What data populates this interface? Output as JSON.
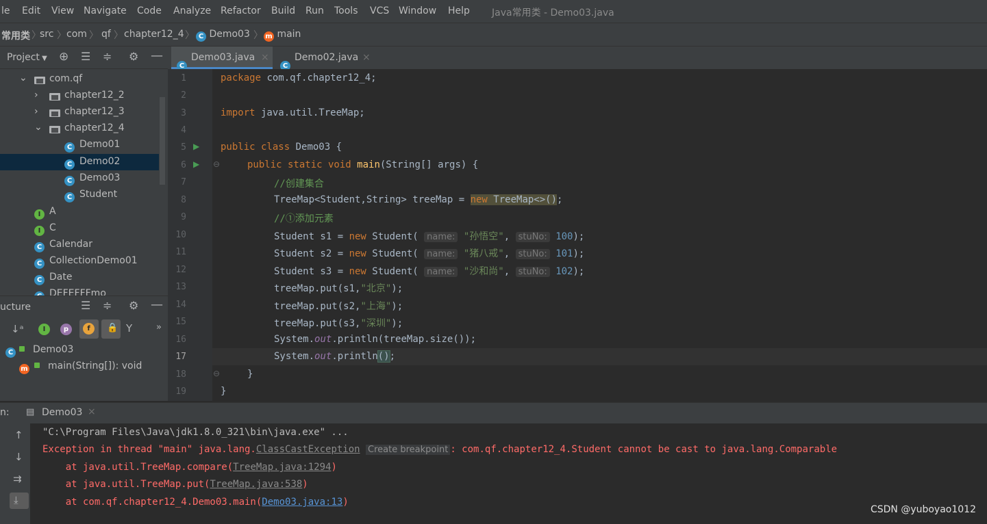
{
  "menu": {
    "items": [
      "le",
      "Edit",
      "View",
      "Navigate",
      "Code",
      "Analyze",
      "Refactor",
      "Build",
      "Run",
      "Tools",
      "VCS",
      "Window",
      "Help"
    ],
    "window_title": "Java常用类 - Demo03.java"
  },
  "breadcrumb": {
    "items": [
      "常用类",
      "src",
      "com",
      "qf",
      "chapter12_4",
      "Demo03",
      "main"
    ]
  },
  "project_panel": {
    "header": "Project",
    "tree": [
      {
        "label": "com.qf",
        "kind": "folder",
        "expanded": true
      },
      {
        "label": "chapter12_2",
        "kind": "folder",
        "expanded": false
      },
      {
        "label": "chapter12_3",
        "kind": "folder",
        "expanded": false
      },
      {
        "label": "chapter12_4",
        "kind": "folder",
        "expanded": true
      },
      {
        "label": "Demo01",
        "kind": "class"
      },
      {
        "label": "Demo02",
        "kind": "class",
        "selected": true
      },
      {
        "label": "Demo03",
        "kind": "class"
      },
      {
        "label": "Student",
        "kind": "class"
      },
      {
        "label": "A",
        "kind": "interface"
      },
      {
        "label": "C",
        "kind": "interface"
      },
      {
        "label": "Calendar",
        "kind": "class"
      },
      {
        "label": "CollectionDemo01",
        "kind": "class"
      },
      {
        "label": "Date",
        "kind": "class"
      },
      {
        "label": "DEFEFFFmo",
        "kind": "class"
      }
    ]
  },
  "structure_panel": {
    "header": "ucture",
    "class_label": "Demo03",
    "method_label": "main(String[]): void",
    "badges": [
      "m",
      "p",
      "f"
    ]
  },
  "tabs": [
    {
      "label": "Demo03.java",
      "active": true
    },
    {
      "label": "Demo02.java",
      "active": false
    }
  ],
  "line_numbers": [
    "1",
    "2",
    "3",
    "4",
    "5",
    "6",
    "7",
    "8",
    "9",
    "10",
    "11",
    "12",
    "13",
    "14",
    "15",
    "16",
    "17",
    "18",
    "19"
  ],
  "code": {
    "l1_kw": "package",
    "l1_rest": " com.qf.chapter12_4;",
    "l3_kw": "import",
    "l3_rest": " java.util.TreeMap;",
    "l5_kw": "public class",
    "l5_rest": " Demo03 {",
    "l6_kw": "public static void",
    "l6_fn": "main",
    "l6_rest": "(String[] args) {",
    "l7_cmt": "//创建集合",
    "l8_a": "TreeMap<Student,String> treeMap = ",
    "l8_kw": "new",
    "l8_b": " TreeMap<>()",
    "l8_c": ";",
    "l9_cmt": "//①添加元素",
    "l10_a": "Student s1 = ",
    "l11_a": "Student s2 = ",
    "l12_a": "Student s3 = ",
    "new_kw": "new",
    "student_call": " Student(",
    "hint_name": "name:",
    "hint_stuno": "stuNo:",
    "s1_name": "\"孙悟空\"",
    "s2_name": "\"猪八戒\"",
    "s3_name": "\"沙和尚\"",
    "s1_no": "100",
    "s2_no": "101",
    "s3_no": "102",
    "close_paren": ");",
    "comma": ", ",
    "l13_a": "treeMap.put(s1,",
    "l13_str": "\"北京\"",
    "l14_a": "treeMap.put(s2,",
    "l14_str": "\"上海\"",
    "l15_a": "treeMap.put(s3,",
    "l15_str": "\"深圳\"",
    "l16_a": "System.",
    "l16_out": "out",
    "l16_b": ".println(treeMap.size());",
    "l17_a": "System.",
    "l17_out": "out",
    "l17_b": ".println",
    "l17_paren": "()",
    "l17_c": ";",
    "l18": "}",
    "l19": "}"
  },
  "run_panel": {
    "label": "n:",
    "tab": "Demo03",
    "lines": {
      "cmd": "\"C:\\Program Files\\Java\\jdk1.8.0_321\\bin\\java.exe\" ...",
      "exc_a": "Exception in thread \"main\" java.lang.",
      "exc_link": "ClassCastException",
      "create_bp": "Create breakpoint",
      "exc_b": ": com.qf.chapter12_4.Student cannot be cast to java.lang.Comparable",
      "at1_a": "    at java.util.TreeMap.compare(",
      "at1_link": "TreeMap.java:1294",
      "at2_a": "    at java.util.TreeMap.put(",
      "at2_link": "TreeMap.java:538",
      "at3_a": "    at com.qf.chapter12_4.Demo03.main(",
      "at3_link": "Demo03.java:13",
      "close": ")"
    }
  },
  "watermark": "CSDN @yuboyao1012"
}
